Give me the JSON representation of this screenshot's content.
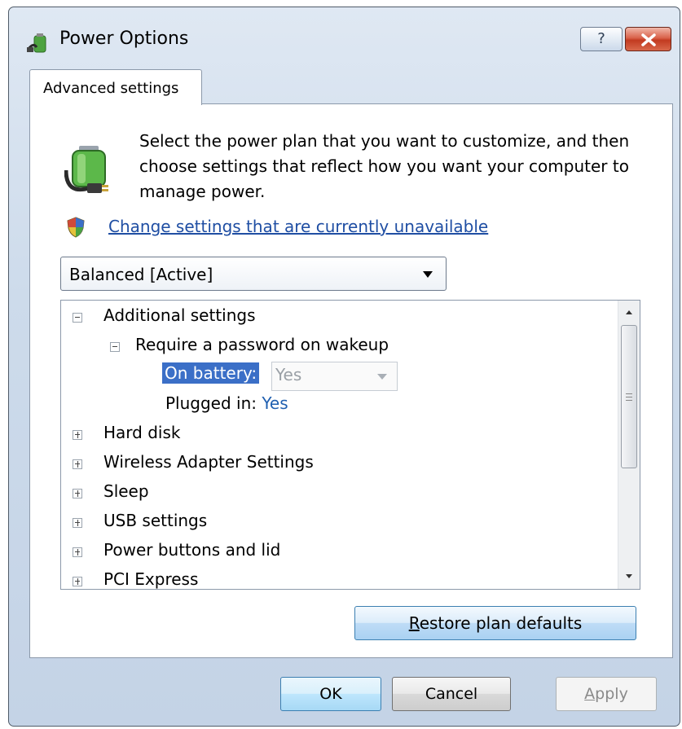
{
  "window": {
    "title": "Power Options",
    "help_glyph": "?",
    "colors": {
      "close_button": "#c23a20",
      "link": "#1f4ea3",
      "selection": "#3b6fc7"
    }
  },
  "tab": {
    "label": "Advanced settings"
  },
  "description": "Select the power plan that you want to customize, and then choose settings that reflect how you want your computer to manage power.",
  "change_link": "Change settings that are currently unavailable",
  "plan_select": {
    "value": "Balanced [Active]"
  },
  "tree": {
    "additional_settings": "Additional settings",
    "require_password": "Require a password on wakeup",
    "on_battery_label": "On battery:",
    "on_battery_value": "Yes",
    "plugged_in_label": "Plugged in:",
    "plugged_in_value": "Yes",
    "items": [
      "Hard disk",
      "Wireless Adapter Settings",
      "Sleep",
      "USB settings",
      "Power buttons and lid",
      "PCI Express"
    ]
  },
  "buttons": {
    "restore_mnemonic": "R",
    "restore_rest": "estore plan defaults",
    "ok": "OK",
    "cancel": "Cancel",
    "apply_mnemonic": "A",
    "apply_rest": "pply"
  }
}
